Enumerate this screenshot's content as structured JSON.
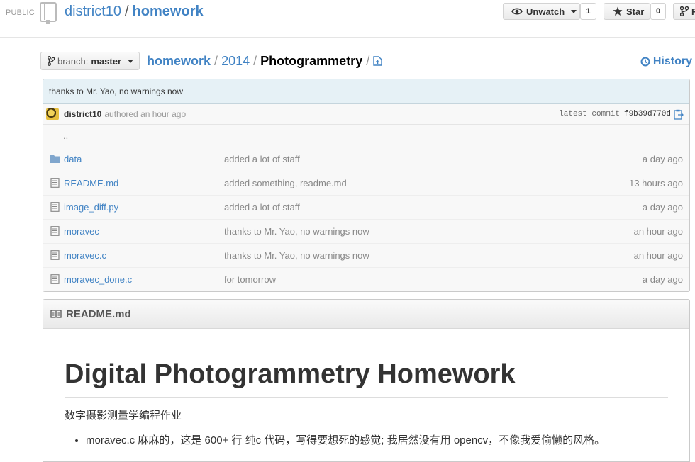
{
  "header": {
    "public_label": "PUBLIC",
    "owner": "district10",
    "separator": "/",
    "repo": "homework",
    "unwatch_label": "Unwatch",
    "unwatch_count": "1",
    "star_label": "Star",
    "star_count": "0",
    "fork_label": "F"
  },
  "nav": {
    "branch_prefix": "branch:",
    "branch_name": "master",
    "crumbs": [
      "homework",
      "2014",
      "Photogrammetry"
    ],
    "sep": "/",
    "history_label": "History"
  },
  "commit": {
    "message": "thanks to Mr. Yao, no warnings now",
    "author": "district10",
    "authored_text": "authored an hour ago",
    "latest_label": "latest commit",
    "sha": "f9b39d770d"
  },
  "files": {
    "up_label": "..",
    "rows": [
      {
        "name": "data",
        "type": "folder",
        "message": "added a lot of staff",
        "age": "a day ago"
      },
      {
        "name": "README.md",
        "type": "file",
        "message": "added something, readme.md",
        "age": "13 hours ago"
      },
      {
        "name": "image_diff.py",
        "type": "file",
        "message": "added a lot of staff",
        "age": "a day ago"
      },
      {
        "name": "moravec",
        "type": "file",
        "message": "thanks to Mr. Yao, no warnings now",
        "age": "an hour ago"
      },
      {
        "name": "moravec.c",
        "type": "file",
        "message": "thanks to Mr. Yao, no warnings now",
        "age": "an hour ago"
      },
      {
        "name": "moravec_done.c",
        "type": "file",
        "message": "for tomorrow",
        "age": "a day ago"
      }
    ]
  },
  "readme": {
    "filename": "README.md",
    "heading": "Digital Photogrammetry Homework",
    "subtitle": "数字摄影测量学编程作业",
    "bullet1": "moravec.c 麻麻的，这是 600+ 行 纯c 代码，写得要想死的感觉; 我居然没有用 opencv，不像我爱偷懒的风格。"
  },
  "colors": {
    "link": "#4183c4",
    "commit_bg": "#e6f1f6",
    "row_bg": "#f8f8f8"
  }
}
